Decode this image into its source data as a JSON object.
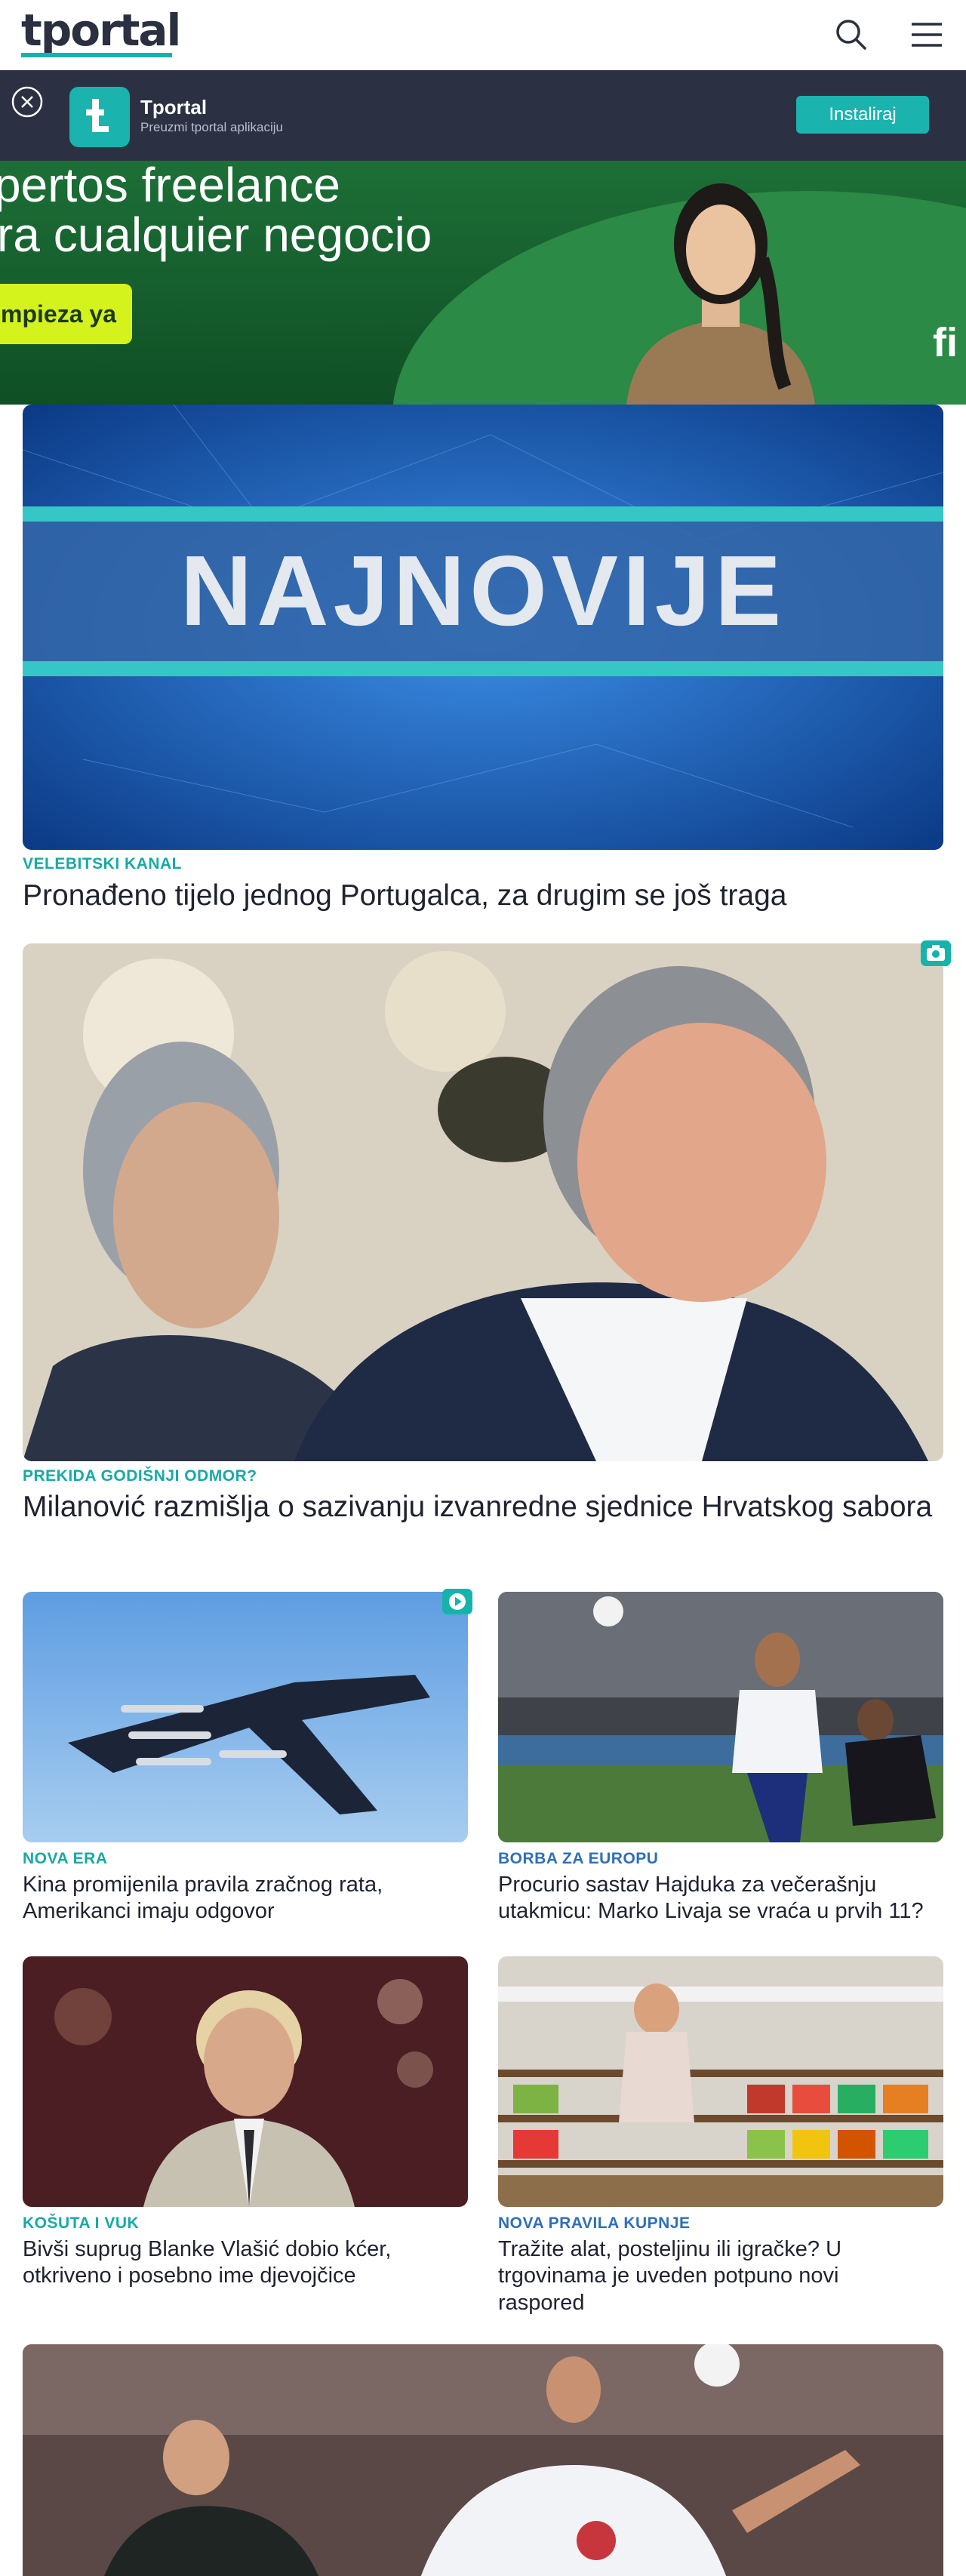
{
  "header": {
    "logo": "tportal",
    "search_icon": "search-icon",
    "menu_icon": "hamburger-menu-icon"
  },
  "app_banner": {
    "name": "Tportal",
    "subtitle": "Preuzmi tportal aplikaciju",
    "install_label": "Instaliraj",
    "icon_letter": "t"
  },
  "ad": {
    "line1": "pertos freelance",
    "line2": "ra cualquier negocio",
    "cta": "mpieza ya",
    "brand": "fi"
  },
  "articles": [
    {
      "image_text": "NAJNOVIJE",
      "kicker": "VELEBITSKI KANAL",
      "title": "Pronađeno tijelo jednog Portugalca, za drugim se još traga"
    },
    {
      "badge": "camera-icon",
      "kicker": "PREKIDA GODIŠNJI ODMOR?",
      "title": "Milanović razmišlja o sazivanju izvanredne sjednice Hrvatskog sabora"
    },
    {
      "badge": "play-icon",
      "kicker": "NOVA ERA",
      "title": "Kina promijenila pravila zračnog rata, Amerikanci imaju odgovor"
    },
    {
      "kicker": "BORBA ZA EUROPU",
      "title": "Procurio sastav Hajduka za večerašnju utakmicu: Marko Livaja se vraća u prvih 11?"
    },
    {
      "kicker": "KOŠUTA I VUK",
      "title": "Bivši suprug Blanke Vlašić dobio kćer, otkriveno i posebno ime djevojčice"
    },
    {
      "kicker": "NOVA PRAVILA KUPNJE",
      "title": "Tražite alat, posteljinu ili igračke? U trgovinama je uveden potpuno novi raspored"
    }
  ],
  "colors": {
    "accent": "#16aaa4",
    "kicker_blue": "#2f6fb8",
    "app_banner_bg": "#2b3142"
  }
}
